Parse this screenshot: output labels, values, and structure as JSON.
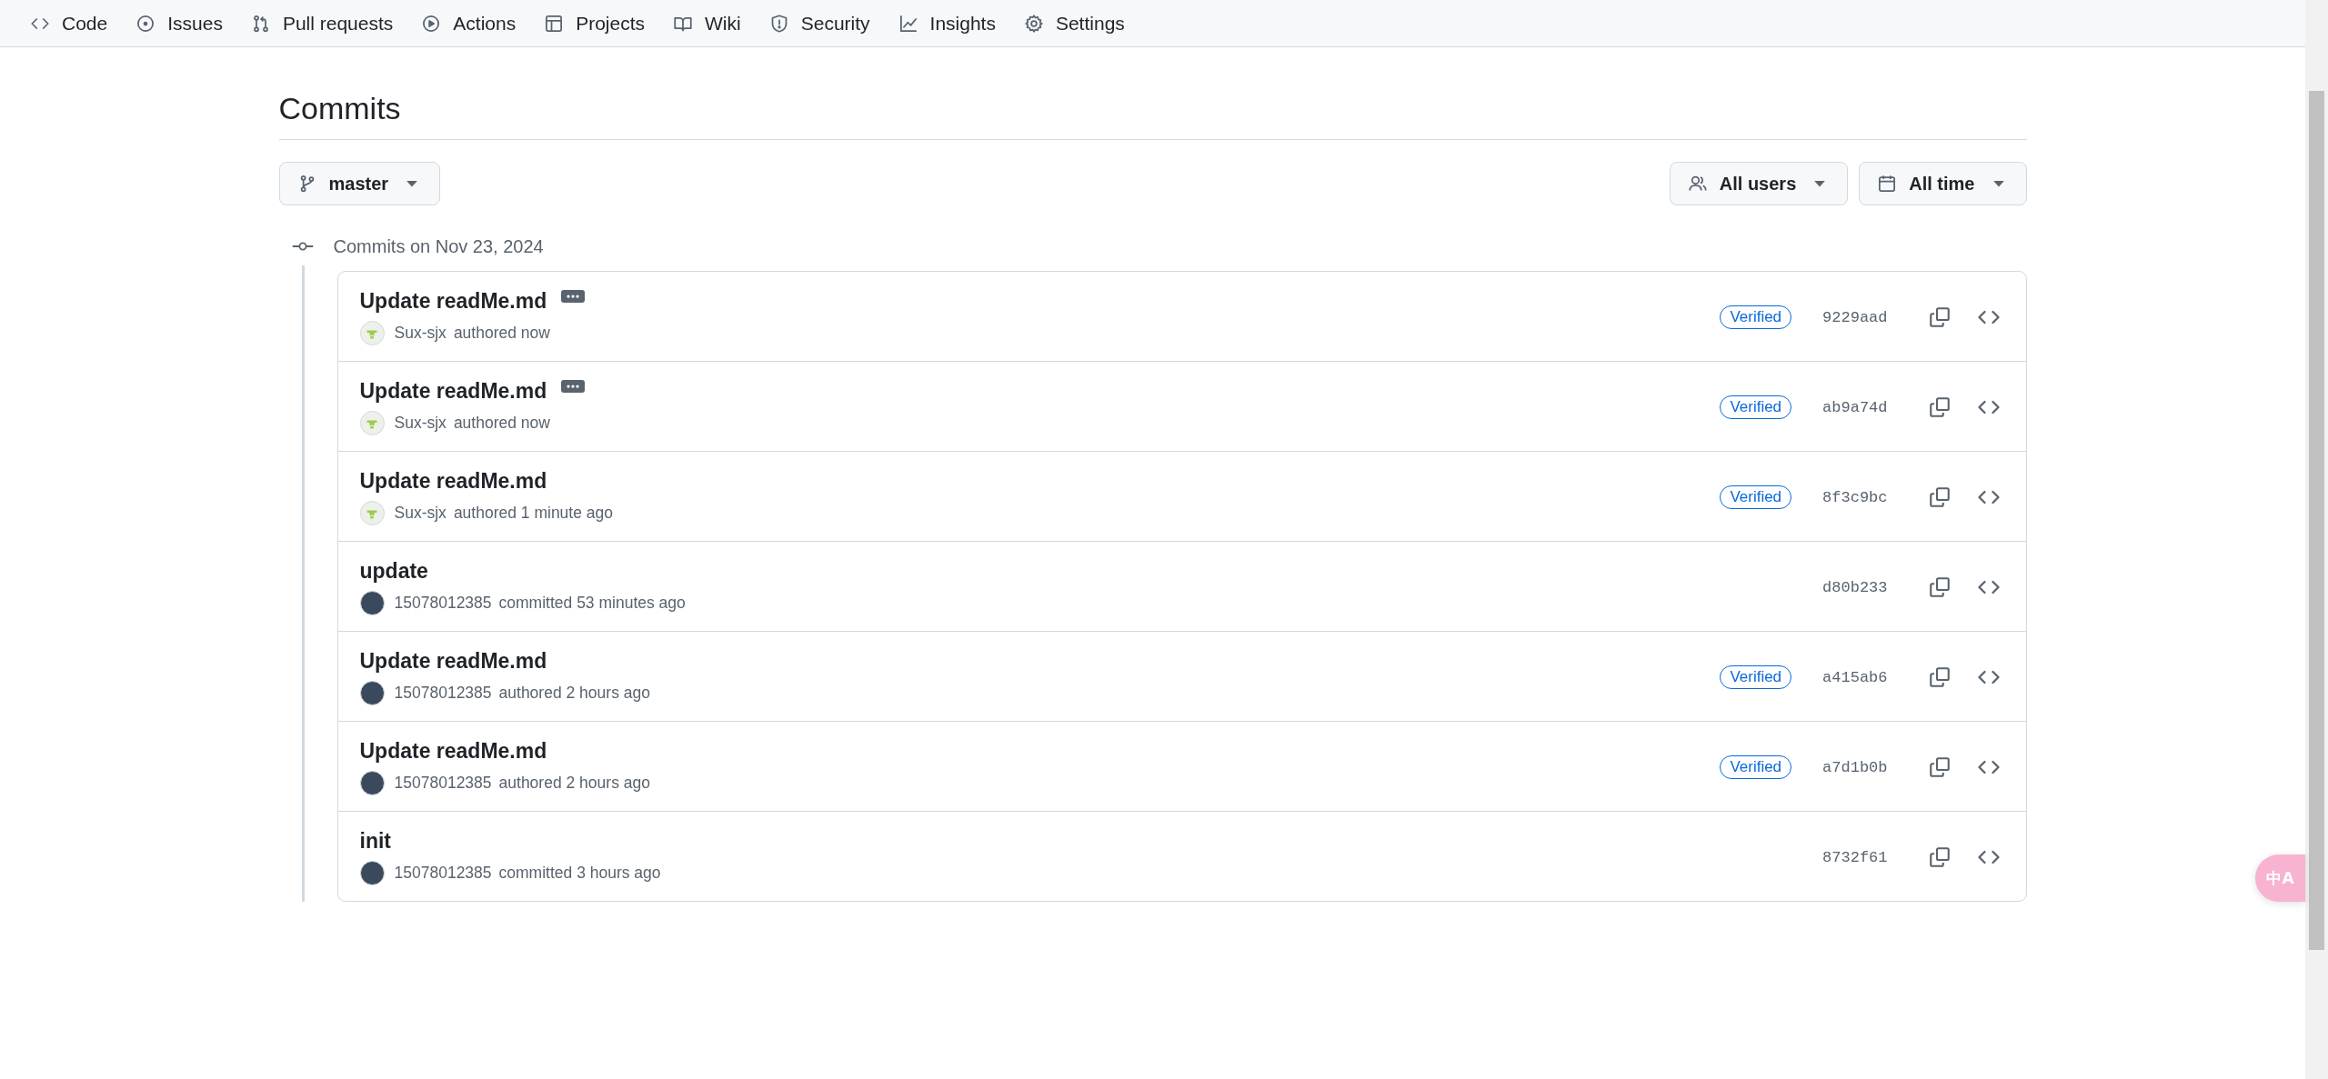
{
  "nav": [
    {
      "label": "Code"
    },
    {
      "label": "Issues"
    },
    {
      "label": "Pull requests"
    },
    {
      "label": "Actions"
    },
    {
      "label": "Projects"
    },
    {
      "label": "Wiki"
    },
    {
      "label": "Security"
    },
    {
      "label": "Insights"
    },
    {
      "label": "Settings"
    }
  ],
  "title": "Commits",
  "branch": "master",
  "filters": [
    {
      "label": "All users"
    },
    {
      "label": "All time"
    }
  ],
  "group": {
    "heading": "Commits on Nov 23, 2024",
    "commits": [
      {
        "message": "Update readMe.md",
        "expandable": true,
        "kind": "identicon",
        "author": "Sux-sjx",
        "action": "authored now",
        "verified": true,
        "verified_label": "Verified",
        "sha": "9229aad"
      },
      {
        "message": "Update readMe.md",
        "expandable": true,
        "kind": "identicon",
        "author": "Sux-sjx",
        "action": "authored now",
        "verified": true,
        "verified_label": "Verified",
        "sha": "ab9a74d"
      },
      {
        "message": "Update readMe.md",
        "expandable": false,
        "kind": "identicon",
        "author": "Sux-sjx",
        "action": "authored 1 minute ago",
        "verified": true,
        "verified_label": "Verified",
        "sha": "8f3c9bc"
      },
      {
        "message": "update",
        "expandable": false,
        "kind": "photo",
        "author": "15078012385",
        "action": "committed 53 minutes ago",
        "verified": false,
        "sha": "d80b233"
      },
      {
        "message": "Update readMe.md",
        "expandable": false,
        "kind": "photo",
        "author": "15078012385",
        "action": "authored 2 hours ago",
        "verified": true,
        "verified_label": "Verified",
        "sha": "a415ab6"
      },
      {
        "message": "Update readMe.md",
        "expandable": false,
        "kind": "photo",
        "author": "15078012385",
        "action": "authored 2 hours ago",
        "verified": true,
        "verified_label": "Verified",
        "sha": "a7d1b0b"
      },
      {
        "message": "init",
        "expandable": false,
        "kind": "photo",
        "author": "15078012385",
        "action": "committed 3 hours ago",
        "verified": false,
        "sha": "8732f61"
      }
    ]
  },
  "translate_button": "中A"
}
